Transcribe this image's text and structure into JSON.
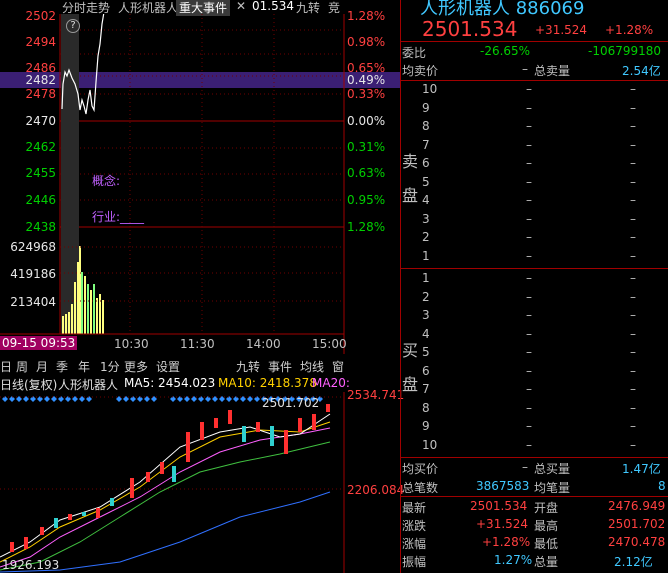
{
  "topbar": {
    "tab_intraday": "分时走势",
    "tab_stock": "人形机器人",
    "tab_event": "重大事件",
    "close_glyph": "✕",
    "price_tail": "01.534",
    "tab_jiuzhuan": "九转",
    "tab_jing": "竞"
  },
  "intraday": {
    "left_prices": [
      "2502",
      "2494",
      "2486",
      "2482",
      "2478",
      "2470",
      "2462",
      "2455",
      "2446",
      "2438"
    ],
    "right_pcts": [
      "1.28%",
      "0.98%",
      "0.65%",
      "0.49%",
      "0.33%",
      "0.00%",
      "0.31%",
      "0.63%",
      "0.95%",
      "1.28%"
    ],
    "volume_labels": [
      "624968",
      "419186",
      "213404"
    ],
    "time_labels": [
      "10:30",
      "11:30",
      "14:00",
      "15:00"
    ],
    "start_time": "09-15 09:53",
    "concept_label": "概念:",
    "industry_label": "行业:____",
    "help_icon": "?"
  },
  "toolbar": {
    "items": [
      "日",
      "周",
      "月",
      "季",
      "年",
      "1分",
      "更多",
      "设置"
    ],
    "right_items": [
      "九转",
      "事件",
      "均线",
      "窗"
    ]
  },
  "kline": {
    "title": "日线(复权)",
    "name": "人形机器人",
    "ma5": "MA5: 2454.023",
    "ma10": "MA10: 2418.378",
    "ma20": "MA20:",
    "peak_label": "2501.702",
    "high_axis": "2534.741",
    "mid_axis": "2206.084",
    "low_label": "1926.193"
  },
  "panel": {
    "title": "人形机器人 886069",
    "price": "2501.534",
    "change": "+31.524",
    "change_pct": "+1.28%",
    "weibi_label": "委比",
    "weibi_value": "-26.65%",
    "weicha_value": "-106799180",
    "avg_sell_label": "均卖价",
    "avg_sell_value": "–",
    "total_sell_label": "总卖量",
    "total_sell_value": "2.54亿",
    "sell_label_1": "卖",
    "sell_label_2": "盘",
    "buy_label_1": "买",
    "buy_label_2": "盘",
    "sell_levels": [
      "10",
      "9",
      "8",
      "7",
      "6",
      "5",
      "4",
      "3",
      "2",
      "1"
    ],
    "buy_levels": [
      "1",
      "2",
      "3",
      "4",
      "5",
      "6",
      "7",
      "8",
      "9",
      "10"
    ],
    "dash": "–",
    "avg_buy_label": "均买价",
    "avg_buy_value": "–",
    "total_buy_label": "总买量",
    "total_buy_value": "1.47亿",
    "total_trades_label": "总笔数",
    "total_trades_value": "3867583",
    "avg_trade_label": "均笔量",
    "avg_trade_value": "8",
    "latest_label": "最新",
    "latest_value": "2501.534",
    "open_label": "开盘",
    "open_value": "2476.949",
    "change_label": "涨跌",
    "change_value": "+31.524",
    "high_label": "最高",
    "high_value": "2501.702",
    "pct_label": "涨幅",
    "pct_value": "+1.28%",
    "low_label": "最低",
    "low_value": "2470.478",
    "amp_label": "振幅",
    "amp_value": "1.27%",
    "vol_label": "总量",
    "vol_value": "2.12亿"
  }
}
